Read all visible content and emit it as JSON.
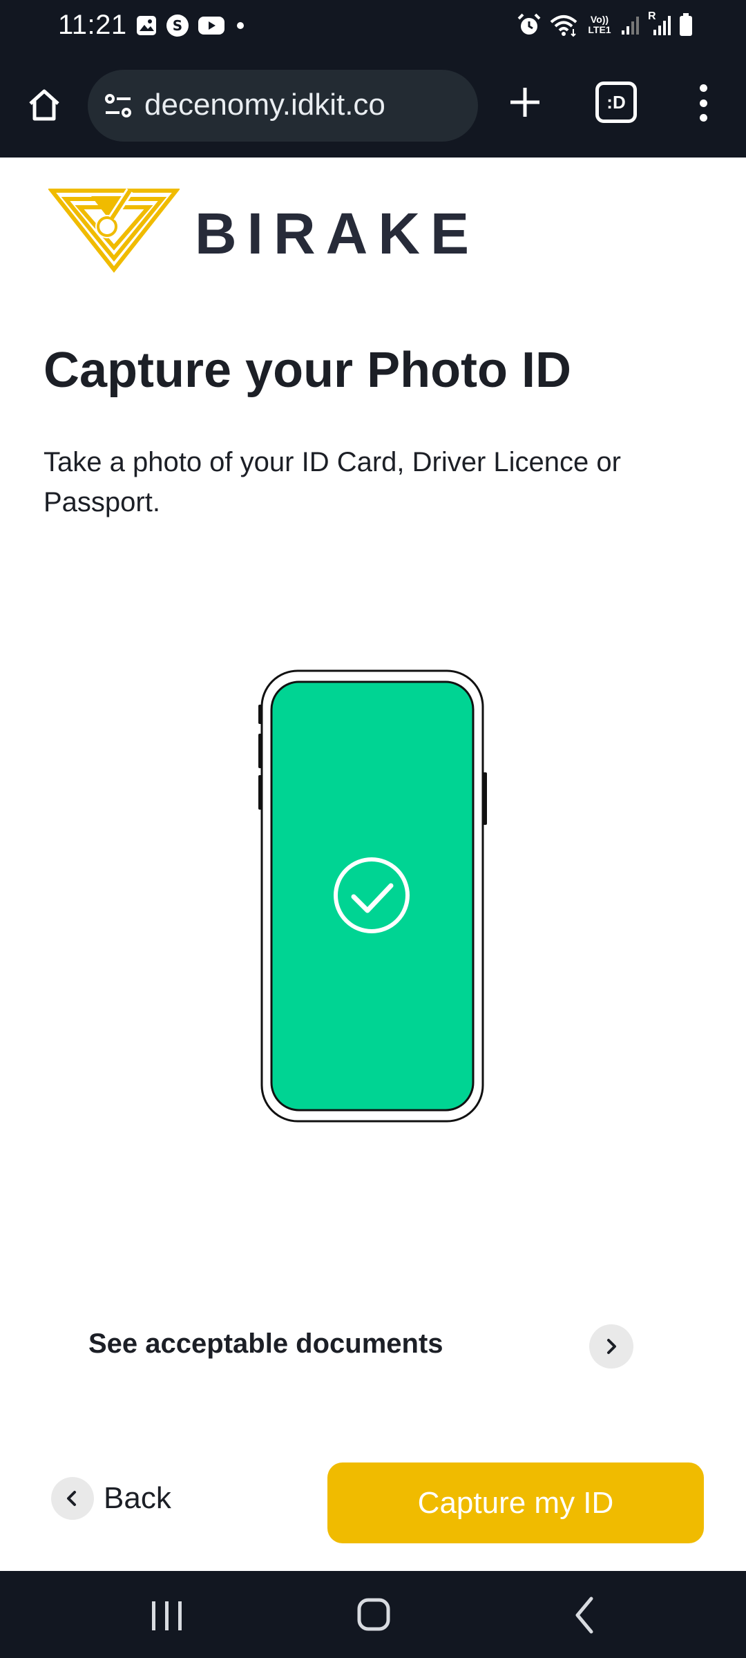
{
  "status_bar": {
    "time": "11:21",
    "left_icons": [
      "gallery-icon",
      "s-app-icon",
      "youtube-icon",
      "dot-icon"
    ],
    "right_icons": [
      "alarm-icon",
      "wifi-icon",
      "volte-lte-icon",
      "signal-icon",
      "signal-roaming-icon",
      "battery-icon"
    ],
    "volte_label": "Vo)) LTE1",
    "roaming_label": "R"
  },
  "browser": {
    "url": "decenomy.idkit.co",
    "tabs_label": ":D",
    "icons": [
      "home-icon",
      "tune-icon",
      "plus-icon",
      "tabs-icon",
      "more-vert-icon"
    ]
  },
  "brand": {
    "name": "BIRAKE",
    "logo_color": "#f0bb00",
    "text_color": "#272b39"
  },
  "page": {
    "title": "Capture your Photo ID",
    "description": "Take a photo of your ID Card, Driver Licence or Passport."
  },
  "illustration": {
    "screen_color": "#00d493",
    "icon": "check-circle-icon"
  },
  "docs_link": {
    "label": "See acceptable documents",
    "icon": "chevron-right-icon"
  },
  "actions": {
    "back_label": "Back",
    "capture_label": "Capture my ID",
    "accent": "#f0bb00"
  },
  "nav_bar": {
    "icons": [
      "recents-icon",
      "home-icon",
      "back-icon"
    ]
  }
}
